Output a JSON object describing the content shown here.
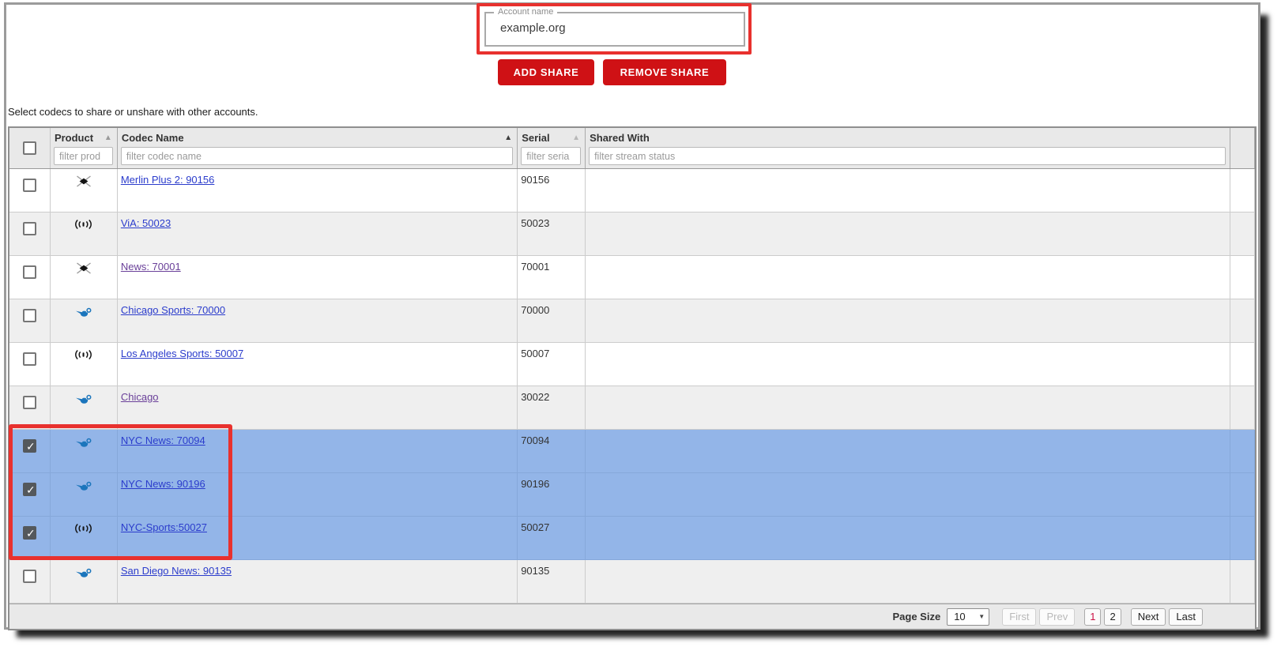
{
  "colors": {
    "annotation-red": "#e8312e",
    "button-red": "#cf1115",
    "selected-row-blue": "#93b5e8",
    "link-blue": "#2b3ccc",
    "link-visited": "#6a4099",
    "active-page-red": "#cc1144"
  },
  "account_field": {
    "label": "Account name",
    "value": "example.org"
  },
  "actions": {
    "add_share": "ADD SHARE",
    "remove_share": "REMOVE SHARE"
  },
  "instruction": "Select codecs to share or unshare with other accounts.",
  "table": {
    "headers": {
      "product": "Product",
      "codec_name": "Codec Name",
      "serial": "Serial",
      "shared_with": "Shared With"
    },
    "sort_arrow": "▲",
    "filter_placeholders": {
      "product": "filter prod",
      "codec_name": "filter codec name",
      "serial": "filter seria",
      "shared_with": "filter stream status"
    },
    "rows": [
      {
        "product_icon": "merlin-x",
        "label": "Merlin Plus 2: 90156",
        "serial": "90156",
        "shared_with": "",
        "checked": false,
        "selected": false,
        "visited": false
      },
      {
        "product_icon": "via-radio",
        "label": "ViA: 50023",
        "serial": "50023",
        "shared_with": "",
        "checked": false,
        "selected": false,
        "visited": false
      },
      {
        "product_icon": "merlin-x",
        "label": "News: 70001",
        "serial": "70001",
        "shared_with": "",
        "checked": false,
        "selected": false,
        "visited": true
      },
      {
        "product_icon": "genie-lamp",
        "label": "Chicago Sports: 70000",
        "serial": "70000",
        "shared_with": "",
        "checked": false,
        "selected": false,
        "visited": false
      },
      {
        "product_icon": "via-radio",
        "label": "Los Angeles Sports: 50007",
        "serial": "50007",
        "shared_with": "",
        "checked": false,
        "selected": false,
        "visited": false
      },
      {
        "product_icon": "genie-lamp",
        "label": "Chicago",
        "serial": "30022",
        "shared_with": "",
        "checked": false,
        "selected": false,
        "visited": true
      },
      {
        "product_icon": "genie-lamp",
        "label": "NYC News: 70094",
        "serial": "70094",
        "shared_with": "",
        "checked": true,
        "selected": true,
        "visited": false
      },
      {
        "product_icon": "genie-lamp",
        "label": "NYC News: 90196",
        "serial": "90196",
        "shared_with": "",
        "checked": true,
        "selected": true,
        "visited": false
      },
      {
        "product_icon": "via-radio",
        "label": "NYC-Sports:50027",
        "serial": "50027",
        "shared_with": "",
        "checked": true,
        "selected": true,
        "visited": false
      },
      {
        "product_icon": "genie-lamp",
        "label": "San Diego News: 90135",
        "serial": "90135",
        "shared_with": "",
        "checked": false,
        "selected": false,
        "visited": false
      }
    ]
  },
  "pagination": {
    "page_size_label": "Page Size",
    "page_size": "10",
    "first": "First",
    "prev": "Prev",
    "page_1": "1",
    "page_2": "2",
    "next": "Next",
    "last": "Last"
  }
}
